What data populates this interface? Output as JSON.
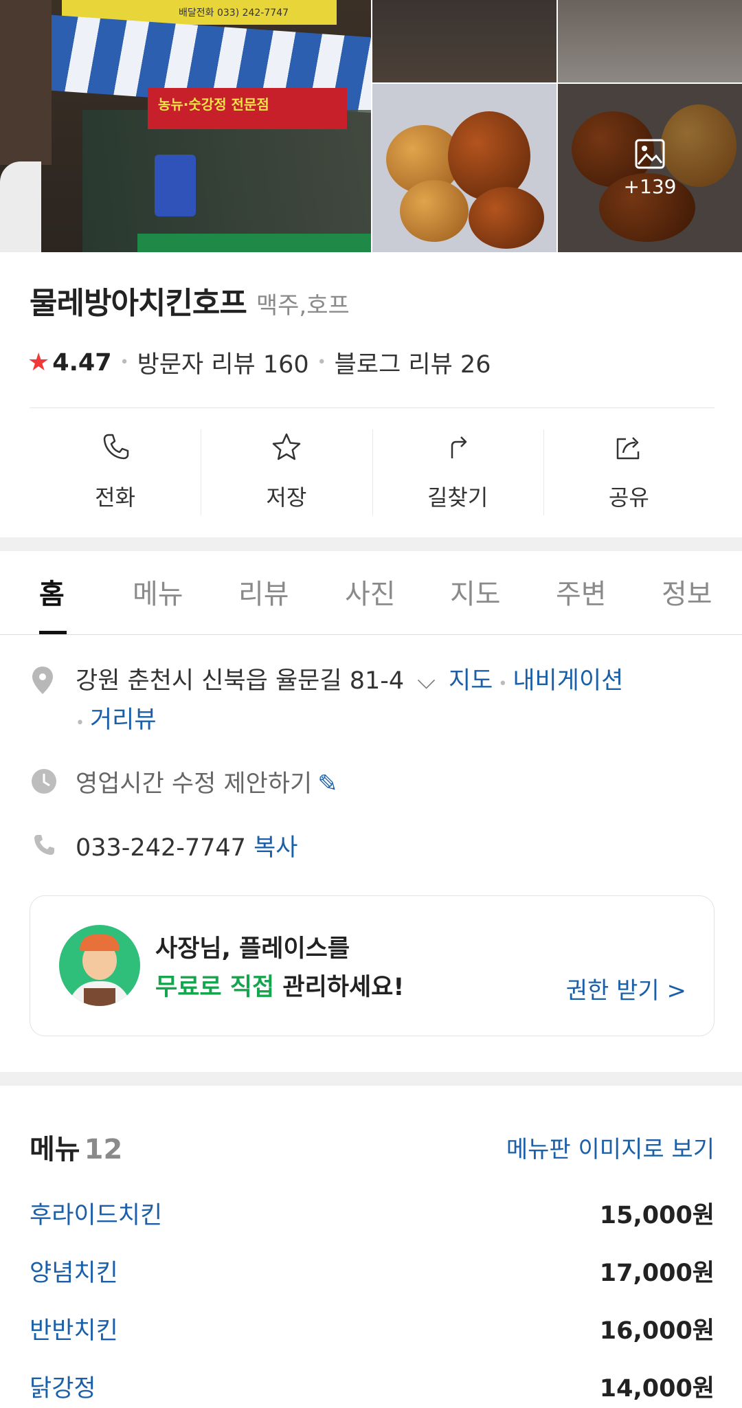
{
  "gallery": {
    "sign_phone": "배달전화 033) 242-7747",
    "banner": "농뉴·숫강정 전문점",
    "more_count": "+139",
    "more_icon": "image-icon"
  },
  "place": {
    "name": "물레방아치킨호프",
    "category": "맥주,호프",
    "rating": "4.47",
    "visitor_reviews": "방문자 리뷰 160",
    "blog_reviews": "블로그 리뷰 26"
  },
  "actions": [
    {
      "label": "전화",
      "icon": "phone-icon"
    },
    {
      "label": "저장",
      "icon": "star-icon"
    },
    {
      "label": "길찾기",
      "icon": "directions-icon"
    },
    {
      "label": "공유",
      "icon": "share-icon"
    }
  ],
  "tabs": [
    "홈",
    "메뉴",
    "리뷰",
    "사진",
    "지도",
    "주변",
    "정보"
  ],
  "info": {
    "address": "강원 춘천시 신북읍 율문길 81-4",
    "map_link": "지도",
    "navigation_link": "내비게이션",
    "streetview_link": "거리뷰",
    "hours_prompt": "영업시간 수정 제안하기",
    "phone": "033-242-7747",
    "copy_label": "복사"
  },
  "owner_card": {
    "line1": "사장님, 플레이스를",
    "line2_highlight": "무료로 직접",
    "line2_rest": " 관리하세요!",
    "cta": "권한 받기 >"
  },
  "menu": {
    "title": "메뉴",
    "count": "12",
    "image_link": "메뉴판 이미지로 보기",
    "items": [
      {
        "name": "후라이드치킨",
        "price": "15,000원"
      },
      {
        "name": "양념치킨",
        "price": "17,000원"
      },
      {
        "name": "반반치킨",
        "price": "16,000원"
      },
      {
        "name": "닭강정",
        "price": "14,000원"
      }
    ]
  },
  "colors": {
    "link": "#1a5fa8",
    "rating_star": "#f03a3a",
    "highlight_green": "#14a54e"
  }
}
